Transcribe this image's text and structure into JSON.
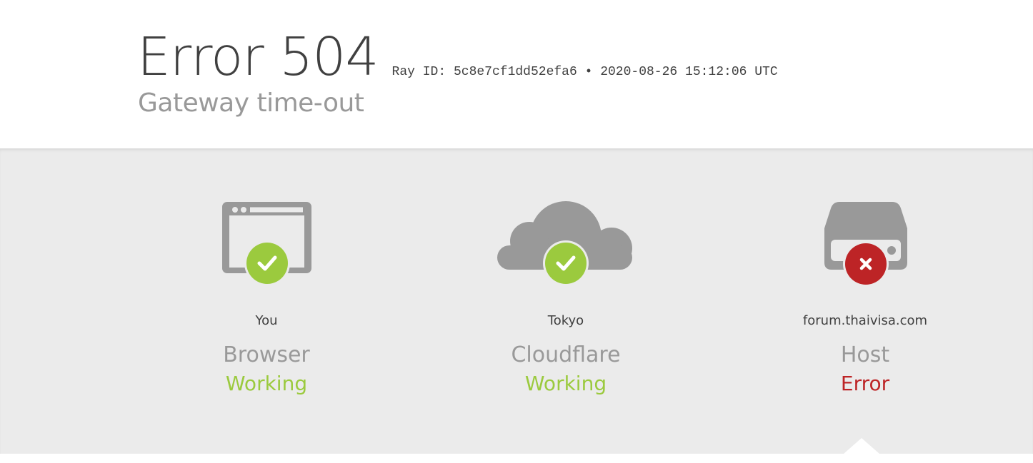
{
  "header": {
    "error_title": "Error 504",
    "ray_line": "Ray ID: 5c8e7cf1dd52efa6 • 2020-08-26 15:12:06 UTC",
    "subtitle": "Gateway time-out"
  },
  "nodes": [
    {
      "location": "You",
      "role": "Browser",
      "status": "Working",
      "status_kind": "ok",
      "icon": "browser-icon"
    },
    {
      "location": "Tokyo",
      "role": "Cloudflare",
      "status": "Working",
      "status_kind": "ok",
      "icon": "cloud-icon"
    },
    {
      "location": "forum.thaivisa.com",
      "role": "Host",
      "status": "Error",
      "status_kind": "error",
      "icon": "server-icon"
    }
  ],
  "colors": {
    "ok": "#9bca3e",
    "error": "#bd2426",
    "icon_gray": "#999999",
    "band": "#ebebeb"
  }
}
